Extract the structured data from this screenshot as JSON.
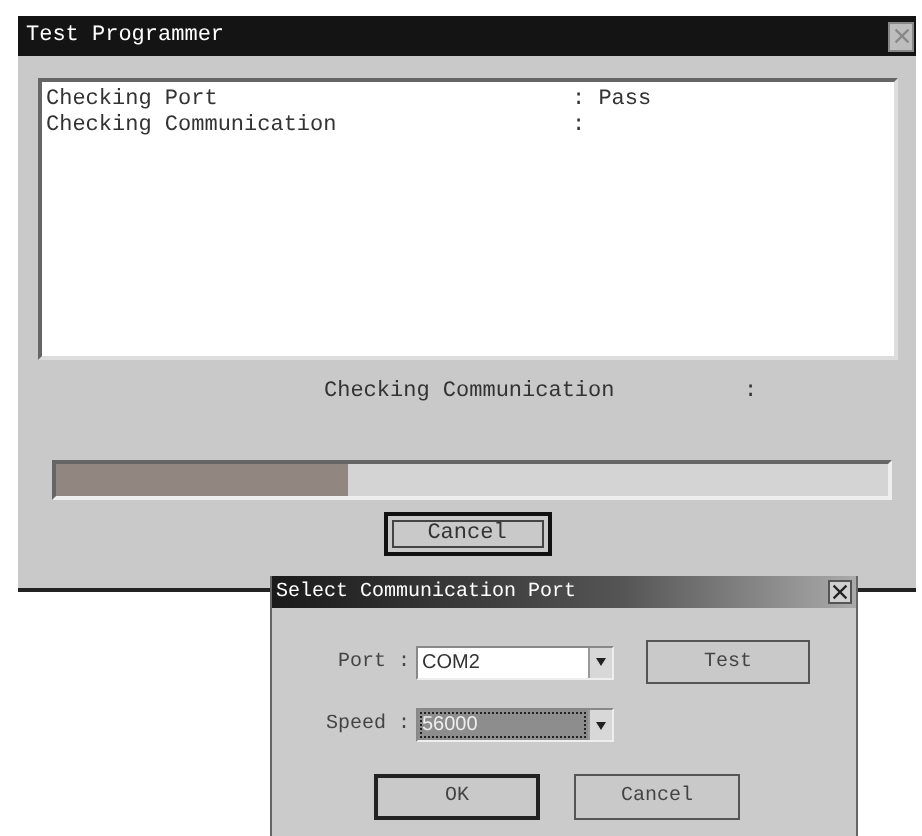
{
  "main_window": {
    "title": "Test Programmer",
    "log_lines": [
      {
        "label": "Checking Port",
        "separator": ":",
        "result": "Pass"
      },
      {
        "label": "Checking Communication",
        "separator": ":"
      }
    ],
    "status": {
      "label": "Checking Communication",
      "separator": ":"
    },
    "progress": {
      "level": 0.35
    },
    "cancel_button": {
      "label": "Cancel",
      "default": true
    }
  },
  "dialog": {
    "title": "Select Communication Port",
    "fields": [
      {
        "label": "Port",
        "separator": ":",
        "value": "COM2",
        "focused": false
      },
      {
        "label": "Speed",
        "separator": ":",
        "value": "56000",
        "focused": true
      }
    ],
    "test_button": {
      "label": "Test"
    },
    "buttons": [
      {
        "label": "OK",
        "default": true
      },
      {
        "label": "Cancel",
        "default": false
      }
    ]
  }
}
